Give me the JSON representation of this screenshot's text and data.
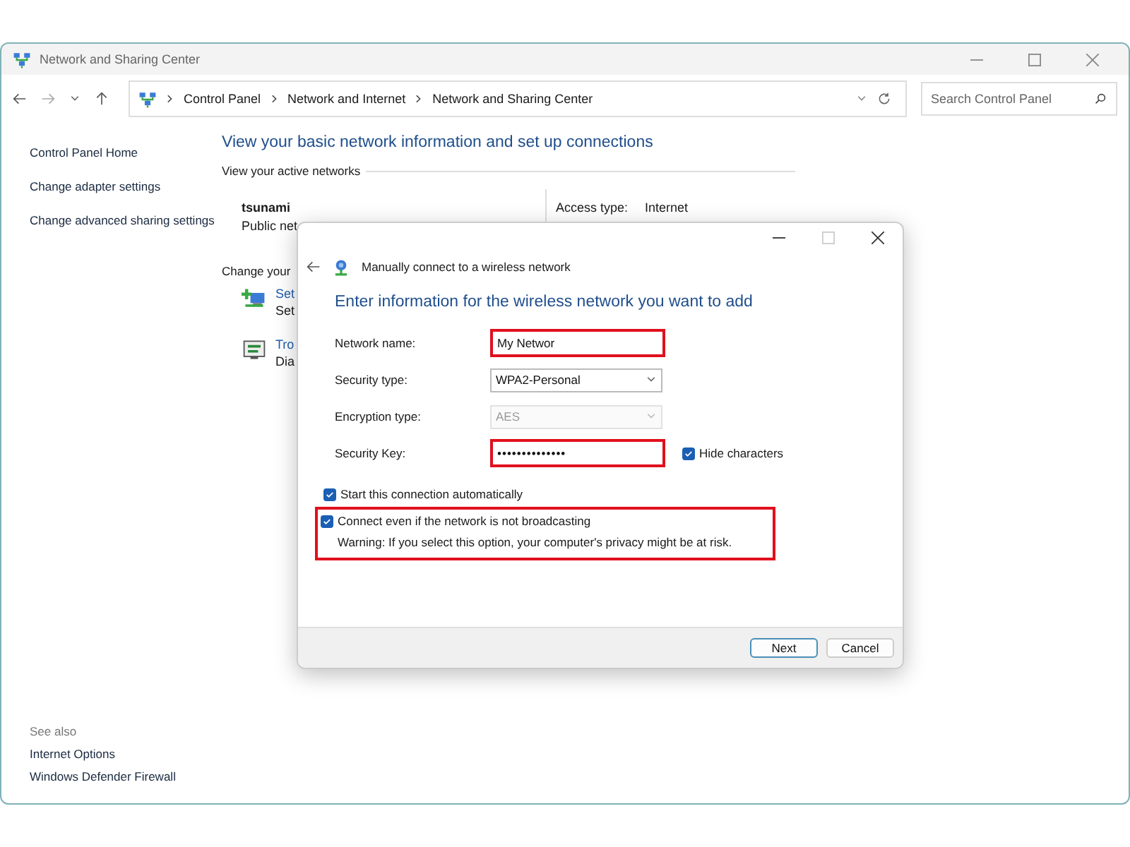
{
  "window": {
    "title": "Network and Sharing Center"
  },
  "address_bar": {
    "breadcrumb": [
      "Control Panel",
      "Network and Internet",
      "Network and Sharing Center"
    ]
  },
  "search": {
    "placeholder": "Search Control Panel"
  },
  "sidebar": {
    "links": [
      "Control Panel Home",
      "Change adapter settings",
      "Change advanced sharing settings"
    ],
    "see_also": {
      "title": "See also",
      "links": [
        "Internet Options",
        "Windows Defender Firewall"
      ]
    }
  },
  "main": {
    "heading": "View your basic network information and set up connections",
    "active_networks_label": "View your active networks",
    "network": {
      "name": "tsunami",
      "type": "Public net",
      "access_label": "Access type:",
      "access_value": "Internet"
    },
    "change_label": "Change your",
    "tasks": [
      {
        "title": "Set",
        "description": "Set",
        "kind": "setup"
      },
      {
        "title": "Tro",
        "description": "Dia",
        "kind": "troubleshoot"
      }
    ]
  },
  "dialog": {
    "title": "Manually connect to a wireless network",
    "heading": "Enter information for the wireless network you want to add",
    "fields": [
      {
        "label": "Network name:",
        "kind": "text",
        "value": "My Networ",
        "highlighted": true,
        "disabled": false
      },
      {
        "label": "Security type:",
        "kind": "select",
        "value": "WPA2-Personal",
        "highlighted": false,
        "disabled": false
      },
      {
        "label": "Encryption type:",
        "kind": "select",
        "value": "AES",
        "highlighted": false,
        "disabled": true
      },
      {
        "label": "Security Key:",
        "kind": "password",
        "value": "••••••••••••••",
        "highlighted": true,
        "disabled": false
      }
    ],
    "hide_characters": {
      "label": "Hide characters",
      "checked": true
    },
    "options": [
      {
        "label": "Start this connection automatically",
        "checked": true,
        "highlighted": false
      },
      {
        "label": "Connect even if the network is not broadcasting",
        "checked": true,
        "highlighted": true,
        "warning": "Warning: If you select this option, your computer's privacy might be at risk."
      }
    ],
    "buttons": [
      {
        "label": "Next",
        "default": true
      },
      {
        "label": "Cancel",
        "default": false
      }
    ]
  }
}
